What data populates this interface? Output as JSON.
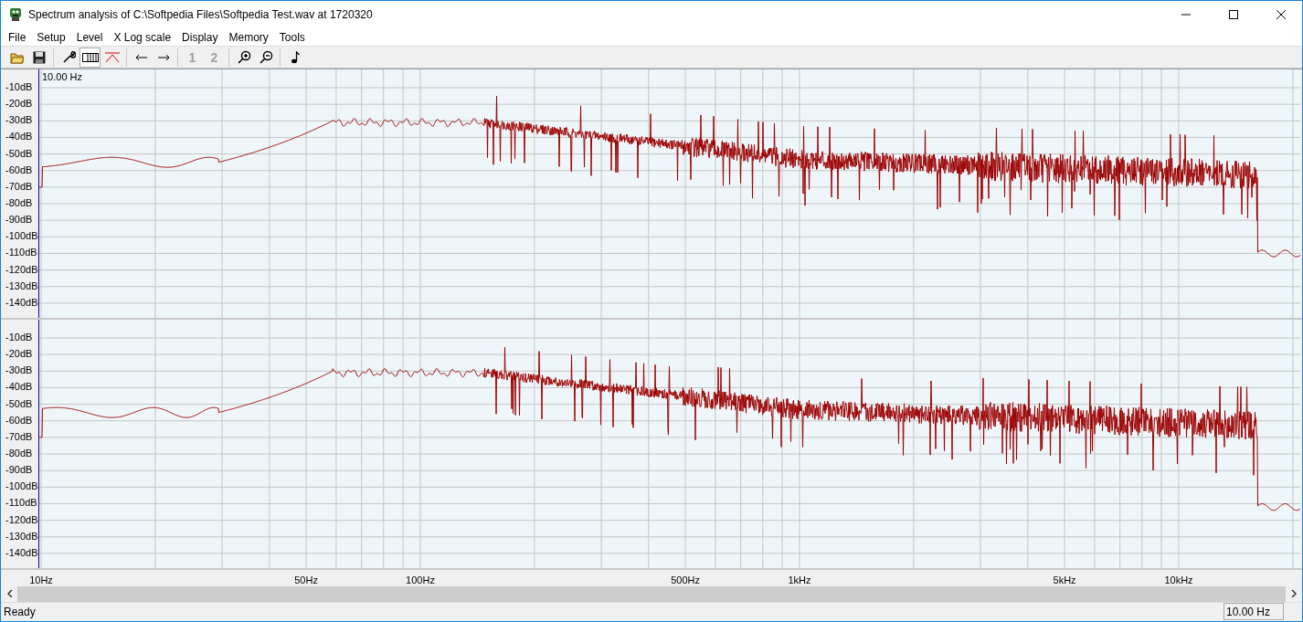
{
  "window": {
    "title": "Spectrum analysis of C:\\Softpedia Files\\Softpedia Test.wav at 1720320"
  },
  "menu": [
    "File",
    "Setup",
    "Level",
    "X Log scale",
    "Display",
    "Memory",
    "Tools"
  ],
  "toolbar": {
    "memory_buttons": [
      {
        "label": "1",
        "disabled": true
      },
      {
        "label": "2",
        "disabled": true
      }
    ]
  },
  "panes": [
    {
      "cursor_label": "10.00 Hz",
      "y_labels": [
        "-10dB",
        "-20dB",
        "-30dB",
        "-40dB",
        "-50dB",
        "-60dB",
        "-70dB",
        "-80dB",
        "-90dB",
        "-100dB",
        "-110dB",
        "-120dB",
        "-130dB",
        "-140dB"
      ]
    },
    {
      "y_labels": [
        "-10dB",
        "-20dB",
        "-30dB",
        "-40dB",
        "-50dB",
        "-60dB",
        "-70dB",
        "-80dB",
        "-90dB",
        "-100dB",
        "-110dB",
        "-120dB",
        "-130dB",
        "-140dB"
      ]
    }
  ],
  "x_axis": [
    "10Hz",
    "50Hz",
    "100Hz",
    "500Hz",
    "1kHz",
    "5kHz",
    "10kHz"
  ],
  "status_bar": {
    "text": "Ready",
    "frequency": "10.00 Hz"
  }
}
